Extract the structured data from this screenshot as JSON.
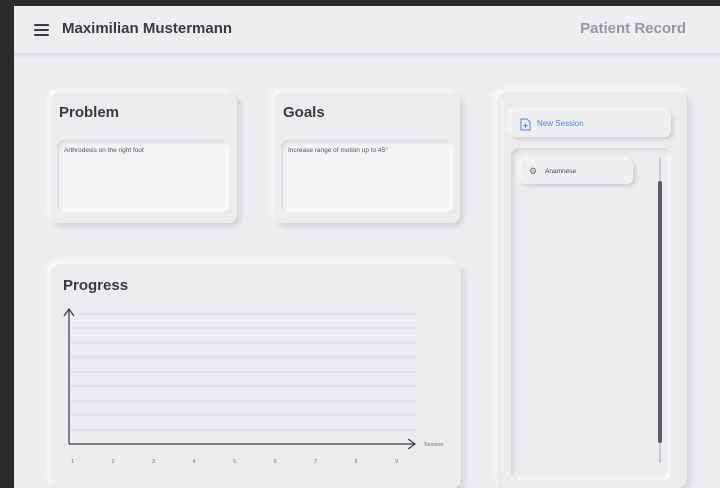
{
  "header": {
    "patient_name": "Maximilian Mustermann",
    "screen_title": "Patient Record"
  },
  "problem": {
    "title": "Problem",
    "text": "Arthrodesis on the right foot"
  },
  "goals": {
    "title": "Goals",
    "text": "Increase range of motion up to 45°"
  },
  "progress": {
    "title": "Progress"
  },
  "sidebar": {
    "new_session_label": "New Session",
    "sessions": [
      {
        "label": "Anamnese"
      }
    ]
  },
  "colors": {
    "accent": "#4f86d9",
    "background": "#ededf0",
    "title_text": "#3a3a40",
    "muted_text": "#96969c"
  },
  "chart_data": {
    "type": "line",
    "title": "Progress",
    "xlabel": "Session",
    "ylabel": "",
    "categories": [
      "1",
      "2",
      "3",
      "4",
      "5",
      "6",
      "7",
      "8",
      "9"
    ],
    "series": [],
    "grid": true
  }
}
